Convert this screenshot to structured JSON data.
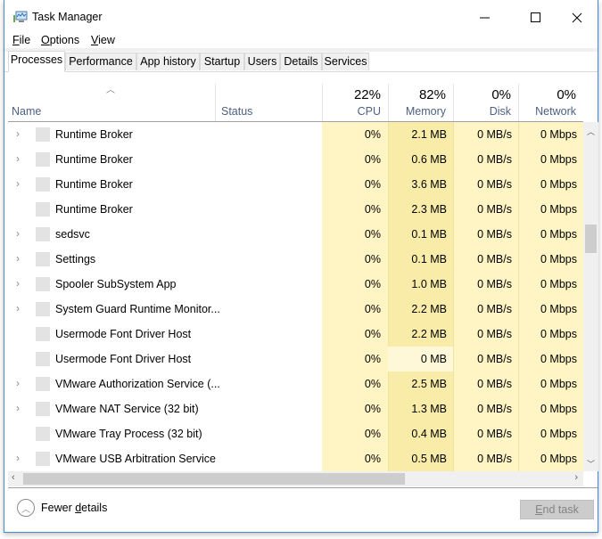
{
  "window": {
    "title": "Task Manager",
    "controls": {
      "minimize": "minimize-icon",
      "maximize": "maximize-icon",
      "close": "close-icon"
    }
  },
  "menu": [
    {
      "label": "File",
      "accel": "F",
      "rest": "ile"
    },
    {
      "label": "Options",
      "accel": "O",
      "rest": "ptions"
    },
    {
      "label": "View",
      "accel": "V",
      "rest": "iew"
    }
  ],
  "tabs": [
    {
      "label": "Processes",
      "active": true
    },
    {
      "label": "Performance"
    },
    {
      "label": "App history"
    },
    {
      "label": "Startup"
    },
    {
      "label": "Users"
    },
    {
      "label": "Details"
    },
    {
      "label": "Services"
    }
  ],
  "columns": {
    "name": "Name",
    "status": "Status",
    "cpu": {
      "label": "CPU",
      "pct": "22%"
    },
    "memory": {
      "label": "Memory",
      "pct": "82%"
    },
    "disk": {
      "label": "Disk",
      "pct": "0%"
    },
    "network": {
      "label": "Network",
      "pct": "0%"
    }
  },
  "colors": {
    "heat_light": "#fff4c4",
    "heat_medium": "#f9eca8",
    "heat_lightest": "#fff8d8",
    "window_border": "#3c8ad8"
  },
  "rows": [
    {
      "name": "Runtime Broker",
      "expandable": true,
      "status": "",
      "cpu": "0%",
      "memory": "2.1 MB",
      "disk": "0 MB/s",
      "network": "0 Mbps"
    },
    {
      "name": "Runtime Broker",
      "expandable": true,
      "status": "",
      "cpu": "0%",
      "memory": "0.6 MB",
      "disk": "0 MB/s",
      "network": "0 Mbps"
    },
    {
      "name": "Runtime Broker",
      "expandable": true,
      "status": "",
      "cpu": "0%",
      "memory": "3.6 MB",
      "disk": "0 MB/s",
      "network": "0 Mbps"
    },
    {
      "name": "Runtime Broker",
      "expandable": false,
      "status": "",
      "cpu": "0%",
      "memory": "2.3 MB",
      "disk": "0 MB/s",
      "network": "0 Mbps"
    },
    {
      "name": "sedsvc",
      "expandable": true,
      "status": "",
      "cpu": "0%",
      "memory": "0.1 MB",
      "disk": "0 MB/s",
      "network": "0 Mbps"
    },
    {
      "name": "Settings",
      "expandable": true,
      "status": "",
      "cpu": "0%",
      "memory": "0.1 MB",
      "disk": "0 MB/s",
      "network": "0 Mbps"
    },
    {
      "name": "Spooler SubSystem App",
      "expandable": true,
      "status": "",
      "cpu": "0%",
      "memory": "1.0 MB",
      "disk": "0 MB/s",
      "network": "0 Mbps"
    },
    {
      "name": "System Guard Runtime Monitor...",
      "expandable": true,
      "status": "",
      "cpu": "0%",
      "memory": "2.2 MB",
      "disk": "0 MB/s",
      "network": "0 Mbps"
    },
    {
      "name": "Usermode Font Driver Host",
      "expandable": false,
      "status": "",
      "cpu": "0%",
      "memory": "2.2 MB",
      "disk": "0 MB/s",
      "network": "0 Mbps"
    },
    {
      "name": "Usermode Font Driver Host",
      "expandable": false,
      "status": "",
      "cpu": "0%",
      "memory": "0 MB",
      "disk": "0 MB/s",
      "network": "0 Mbps"
    },
    {
      "name": "VMware Authorization Service (...",
      "expandable": true,
      "status": "",
      "cpu": "0%",
      "memory": "2.5 MB",
      "disk": "0 MB/s",
      "network": "0 Mbps"
    },
    {
      "name": "VMware NAT Service (32 bit)",
      "expandable": true,
      "status": "",
      "cpu": "0%",
      "memory": "1.3 MB",
      "disk": "0 MB/s",
      "network": "0 Mbps"
    },
    {
      "name": "VMware Tray Process (32 bit)",
      "expandable": false,
      "status": "",
      "cpu": "0%",
      "memory": "0.4 MB",
      "disk": "0 MB/s",
      "network": "0 Mbps"
    },
    {
      "name": "VMware USB Arbitration Service",
      "expandable": true,
      "status": "",
      "cpu": "0%",
      "memory": "0.5 MB",
      "disk": "0 MB/s",
      "network": "0 Mbps"
    }
  ],
  "scroll": {
    "vertical_position_fraction": 0.3,
    "horizontal_visible_fraction": 0.7
  },
  "footer": {
    "fewer_details_label": "Fewer details",
    "fewer_details_accel_index": 6,
    "end_task_label": "End task",
    "end_task_enabled": false
  }
}
